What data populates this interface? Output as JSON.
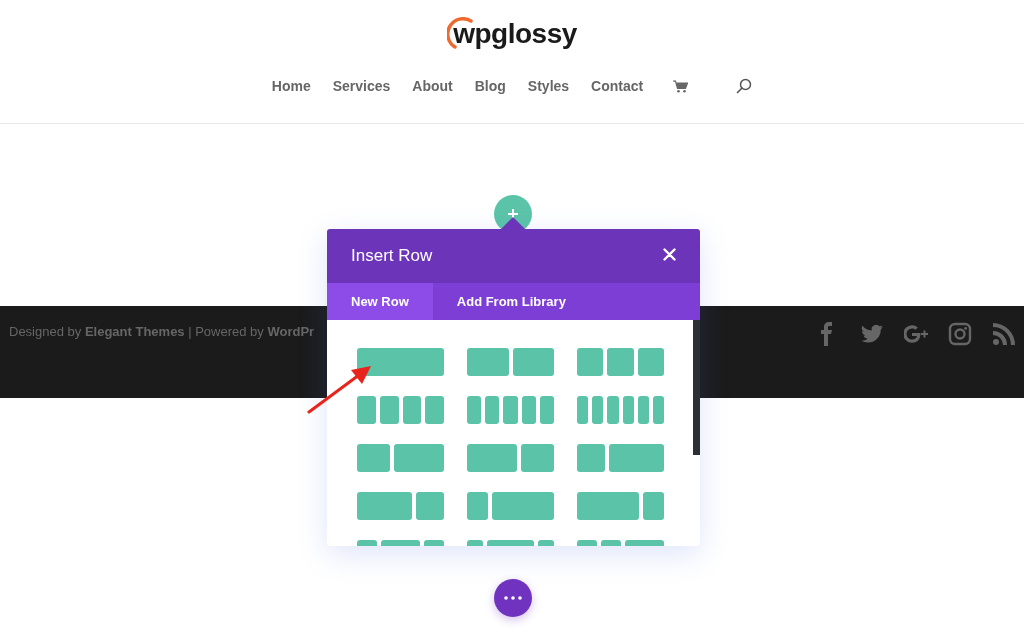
{
  "logo": {
    "text": "wpglossy"
  },
  "nav": {
    "items": [
      {
        "label": "Home"
      },
      {
        "label": "Services"
      },
      {
        "label": "About"
      },
      {
        "label": "Blog"
      },
      {
        "label": "Styles"
      },
      {
        "label": "Contact"
      }
    ]
  },
  "footer": {
    "credits": "Designed by **Elegant Themes** | Powered by **WordPr**"
  },
  "modal": {
    "title": "Insert Row",
    "tabs": [
      {
        "label": "New Row",
        "selected": true
      },
      {
        "label": "Add From Library",
        "selected": false
      }
    ],
    "layouts": [
      {
        "kind": "full"
      },
      {
        "kind": "halves"
      },
      {
        "kind": "thirds"
      },
      {
        "kind": "quarters"
      },
      {
        "kind": "fifths"
      },
      {
        "kind": "sixths"
      },
      {
        "kind": "twofifths"
      },
      {
        "kind": "threefifths"
      },
      {
        "kind": "onethird"
      },
      {
        "kind": "twothirds"
      },
      {
        "kind": "onequarter"
      },
      {
        "kind": "threequarters"
      },
      {
        "kind": "halfcenter"
      },
      {
        "kind": "widecenter"
      },
      {
        "kind": "halfright"
      }
    ]
  }
}
